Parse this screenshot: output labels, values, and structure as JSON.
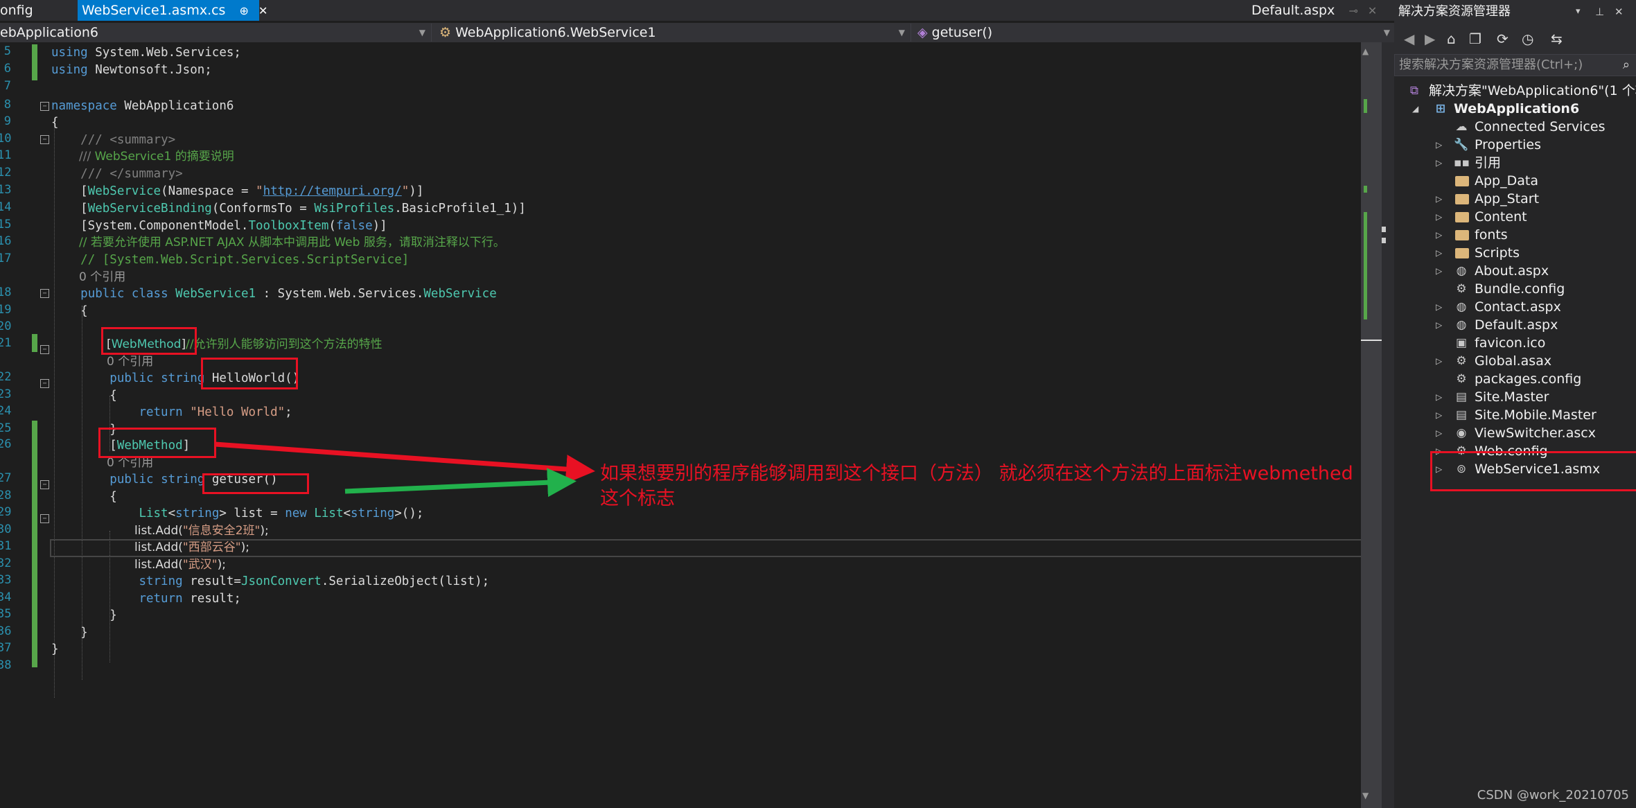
{
  "tabs": {
    "left_partial": "onfig",
    "active": "WebService1.asmx.cs",
    "active_pin": "⊕",
    "active_close": "✕",
    "right": "Default.aspx",
    "right_pin": "⊸",
    "right_close": "✕"
  },
  "nav": {
    "project": "ebApplication6",
    "class": "WebApplication6.WebService1",
    "member": "getuser()"
  },
  "code": {
    "line_numbers": [
      "5",
      "6",
      "7",
      "8",
      "9",
      "10",
      "11",
      "12",
      "13",
      "14",
      "15",
      "16",
      "17",
      "",
      "18",
      "19",
      "20",
      "21",
      "",
      "22",
      "23",
      "24",
      "25",
      "26",
      "",
      "27",
      "28",
      "29",
      "30",
      "31",
      "32",
      "33",
      "34",
      "35",
      "36",
      "37",
      "38"
    ]
  },
  "annotation": {
    "line1": "如果想要别的程序能够调用到这个接口（方法） 就必须在这个方法的上面标注webmethed",
    "line2": "这个标志"
  },
  "solution_explorer": {
    "title": "解决方案资源管理器",
    "title_icons": [
      "▾",
      "⊥",
      "✕"
    ],
    "search_placeholder": "搜索解决方案资源管理器(Ctrl+;)",
    "solution": "解决方案\"WebApplication6\"(1 个项",
    "project": "WebApplication6",
    "items": [
      {
        "label": "Connected Services",
        "icon": "cloud-icon"
      },
      {
        "label": "Properties",
        "icon": "wrench-icon"
      },
      {
        "label": "引用",
        "icon": "references-icon"
      },
      {
        "label": "App_Data",
        "icon": "folder-icon"
      },
      {
        "label": "App_Start",
        "icon": "folder-icon"
      },
      {
        "label": "Content",
        "icon": "folder-icon"
      },
      {
        "label": "fonts",
        "icon": "folder-icon"
      },
      {
        "label": "Scripts",
        "icon": "folder-icon"
      },
      {
        "label": "About.aspx",
        "icon": "web-page-icon"
      },
      {
        "label": "Bundle.config",
        "icon": "config-icon"
      },
      {
        "label": "Contact.aspx",
        "icon": "web-page-icon"
      },
      {
        "label": "Default.aspx",
        "icon": "web-page-icon"
      },
      {
        "label": "favicon.ico",
        "icon": "image-icon"
      },
      {
        "label": "Global.asax",
        "icon": "gear-page-icon"
      },
      {
        "label": "packages.config",
        "icon": "config-icon"
      },
      {
        "label": "Site.Master",
        "icon": "master-page-icon"
      },
      {
        "label": "Site.Mobile.Master",
        "icon": "master-page-icon"
      },
      {
        "label": "ViewSwitcher.ascx",
        "icon": "user-control-icon"
      },
      {
        "label": "Web.config",
        "icon": "config-icon"
      },
      {
        "label": "WebService1.asmx",
        "icon": "web-service-icon"
      }
    ]
  },
  "watermark": "CSDN @work_20210705",
  "colors": {
    "arrow_red": "#e81123",
    "arrow_green": "#22b14c",
    "accent": "#007acc"
  }
}
